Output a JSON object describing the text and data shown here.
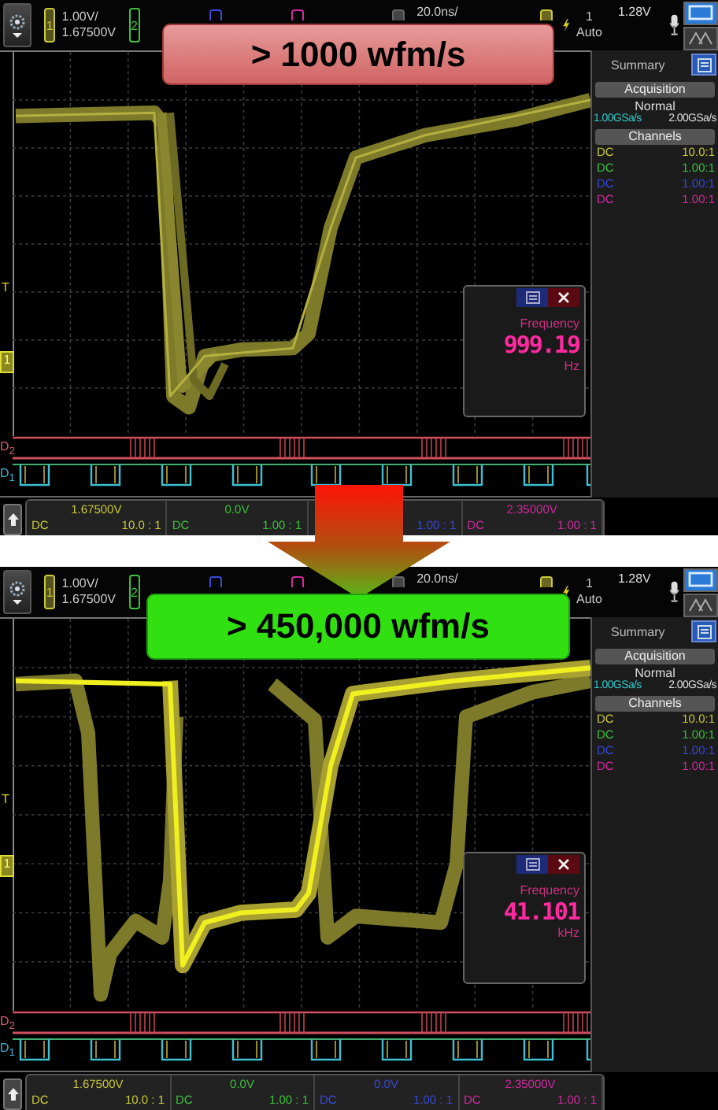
{
  "scopes": [
    {
      "banner": {
        "kind": "slow",
        "text": "> 1000 wfm/s"
      },
      "header": {
        "channels": [
          {
            "label": "1",
            "color": "#c8c83a"
          },
          {
            "label": "2",
            "color": "#3cc03c"
          },
          {
            "color": "#3848d8"
          },
          {
            "color": "#d02aa0"
          }
        ],
        "scale": "1.00V/",
        "offset": "1.67500V",
        "timebase": "20.0ns/",
        "trigger_source": "1",
        "trigger_mode": "Auto",
        "trigger_level": "1.28V"
      },
      "markers": {
        "trigger": "T",
        "ground": "1"
      },
      "digital": [
        {
          "label": "D$_{2}$"
        },
        {
          "label": "D$_{1}$"
        }
      ],
      "measurement": {
        "name": "Frequency",
        "value": "999.19",
        "unit": "Hz"
      },
      "summary": {
        "tab": "Summary",
        "acquisition": "Acquisition",
        "mode": "Normal",
        "sample_rate": "1.00GSa/s",
        "max_rate": "2.00GSa/s",
        "channels_title": "Channels",
        "channels": [
          {
            "coupling": "DC",
            "ratio": "10.0:1",
            "color": "#c8c83a"
          },
          {
            "coupling": "DC",
            "ratio": "1.00:1",
            "color": "#3cc03c"
          },
          {
            "coupling": "DC",
            "ratio": "1.00:1",
            "color": "#3848d8"
          },
          {
            "coupling": "DC",
            "ratio": "1.00:1",
            "color": "#d02aa0"
          }
        ]
      },
      "footer": [
        {
          "offset": "1.67500V",
          "coupling": "DC",
          "ratio": "10.0 : 1",
          "color": "#c8c83a"
        },
        {
          "offset": "0.0V",
          "coupling": "DC",
          "ratio": "1.00 : 1",
          "color": "#3cc03c"
        },
        {
          "ratio": "1.00 : 1",
          "color": "#3848d8"
        },
        {
          "offset": "2.35000V",
          "coupling": "DC",
          "ratio": "1.00 : 1",
          "color": "#d02aa0"
        }
      ]
    },
    {
      "banner": {
        "kind": "fast",
        "text": "> 450,000 wfm/s"
      },
      "header": {
        "channels": [
          {
            "label": "1",
            "color": "#c8c83a"
          },
          {
            "label": "2",
            "color": "#3cc03c"
          },
          {
            "color": "#3848d8"
          },
          {
            "color": "#d02aa0"
          }
        ],
        "scale": "1.00V/",
        "offset": "1.67500V",
        "timebase": "20.0ns/",
        "trigger_source": "1",
        "trigger_mode": "Auto",
        "trigger_level": "1.28V"
      },
      "markers": {
        "trigger": "T",
        "ground": "1"
      },
      "digital": [
        {
          "label": "D$_{2}$"
        },
        {
          "label": "D$_{1}$"
        }
      ],
      "measurement": {
        "name": "Frequency",
        "value": "41.101",
        "unit": "kHz"
      },
      "summary": {
        "tab": "Summary",
        "acquisition": "Acquisition",
        "mode": "Normal",
        "sample_rate": "1.00GSa/s",
        "max_rate": "2.00GSa/s",
        "channels_title": "Channels",
        "channels": [
          {
            "coupling": "DC",
            "ratio": "10.0:1",
            "color": "#c8c83a"
          },
          {
            "coupling": "DC",
            "ratio": "1.00:1",
            "color": "#3cc03c"
          },
          {
            "coupling": "DC",
            "ratio": "1.00:1",
            "color": "#3848d8"
          },
          {
            "coupling": "DC",
            "ratio": "1.00:1",
            "color": "#d02aa0"
          }
        ]
      },
      "footer": [
        {
          "offset": "1.67500V",
          "coupling": "DC",
          "ratio": "10.0 : 1",
          "color": "#c8c83a"
        },
        {
          "offset": "0.0V",
          "coupling": "DC",
          "ratio": "1.00 : 1",
          "color": "#3cc03c"
        },
        {
          "offset": "0.0V",
          "coupling": "DC",
          "ratio": "1.00 : 1",
          "color": "#3848d8"
        },
        {
          "offset": "2.35000V",
          "coupling": "DC",
          "ratio": "1.00 : 1",
          "color": "#d02aa0"
        }
      ]
    }
  ]
}
